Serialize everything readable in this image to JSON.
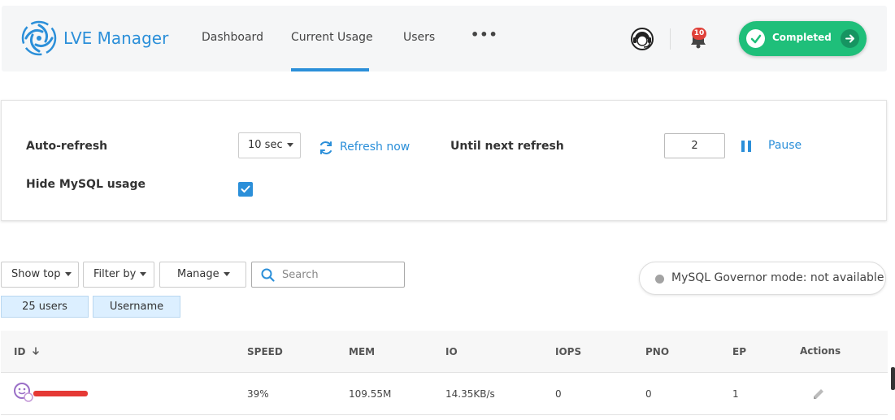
{
  "header": {
    "app_name": "LVE Manager",
    "nav": [
      {
        "label": "Dashboard"
      },
      {
        "label": "Current Usage",
        "active": true
      },
      {
        "label": "Users"
      }
    ],
    "more": "•••",
    "notifications_count": "10",
    "status_button": "Completed"
  },
  "settings": {
    "auto_refresh_label": "Auto-refresh",
    "interval_value": "10 sec",
    "refresh_now": "Refresh now",
    "until_next_label": "Until next refresh",
    "until_next_value": "2",
    "pause": "Pause",
    "hide_mysql_label": "Hide MySQL usage",
    "hide_mysql_checked": true
  },
  "toolbar": {
    "show_top": "Show top",
    "filter_by": "Filter by",
    "manage": "Manage",
    "search_placeholder": "Search",
    "governor_status": "MySQL Governor mode: not available",
    "chips": [
      "25 users",
      "Username"
    ]
  },
  "table": {
    "columns": [
      "ID",
      "SPEED",
      "MEM",
      "IO",
      "IOPS",
      "PNO",
      "EP",
      "Actions"
    ],
    "rows": [
      {
        "speed": "39%",
        "mem": "109.55M",
        "io": "14.35KB/s",
        "iops": "0",
        "pno": "0",
        "ep": "1"
      }
    ]
  },
  "colors": {
    "accent": "#2b8fd9",
    "success": "#1fbf7a",
    "badge": "#e0413a"
  }
}
